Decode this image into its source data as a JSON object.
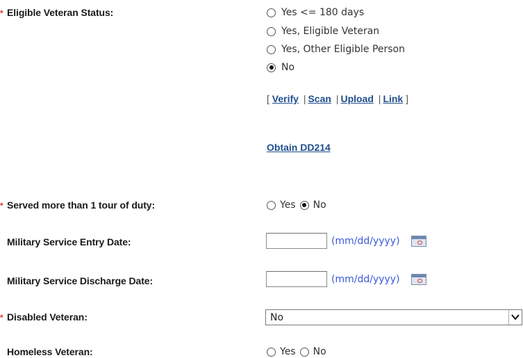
{
  "eligible_veteran": {
    "label": "Eligible Veteran Status:",
    "options": [
      "Yes <= 180 days",
      "Yes, Eligible Veteran",
      "Yes, Other Eligible Person",
      "No"
    ],
    "selected": "No"
  },
  "doc_links": {
    "open": "[",
    "verify": "Verify",
    "scan": "Scan",
    "upload": "Upload",
    "link": "Link",
    "sep": "|",
    "close": "]"
  },
  "obtain_dd214": "Obtain DD214",
  "tour_of_duty": {
    "label": "Served more than 1 tour of duty:",
    "yes": "Yes",
    "no": "No",
    "selected": "No"
  },
  "entry_date": {
    "label": "Military Service Entry Date:",
    "value": "",
    "hint": "(mm/dd/yyyy)"
  },
  "discharge_date": {
    "label": "Military Service Discharge Date:",
    "value": "",
    "hint": "(mm/dd/yyyy)"
  },
  "disabled_veteran": {
    "label": "Disabled Veteran:",
    "selected": "No"
  },
  "homeless_veteran": {
    "label": "Homeless Veteran:",
    "yes": "Yes",
    "no": "No",
    "selected": ""
  },
  "colors": {
    "required_marker": "#e0352b",
    "link": "#1f4e8c",
    "hint": "#3b5bd6"
  }
}
